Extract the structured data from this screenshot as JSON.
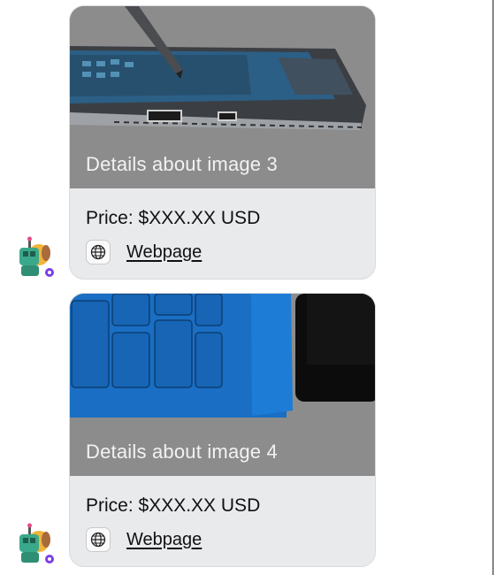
{
  "cards": [
    {
      "caption": "Details about image 3",
      "price": "Price: $XXX.XX USD",
      "link_label": "Webpage",
      "image": "tablet-with-stylus-photo"
    },
    {
      "caption": "Details about image 4",
      "price": "Price: $XXX.XX USD",
      "link_label": "Webpage",
      "image": "blue-keyboard-cover-photo"
    }
  ],
  "icons": {
    "link": "globe-icon",
    "sender": "bot-avatar"
  },
  "colors": {
    "card_background": "#e9eaec",
    "hero_overlay": "#8d8d8d",
    "keyboard_blue": "#1a6fc4"
  }
}
